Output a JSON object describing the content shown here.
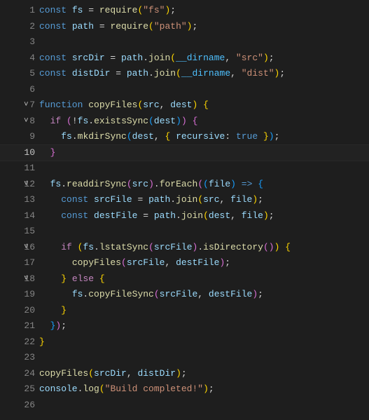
{
  "editor": {
    "language": "javascript",
    "active_line": 10,
    "lines": [
      {
        "n": 1,
        "fold": "",
        "tokens": [
          [
            "kw",
            "const"
          ],
          [
            "",
            ""
          ],
          [
            "var",
            " fs"
          ],
          [
            "punc",
            " = "
          ],
          [
            "fn",
            "require"
          ],
          [
            "brace-y",
            "("
          ],
          [
            "str",
            "\"fs\""
          ],
          [
            "brace-y",
            ")"
          ],
          [
            "punc",
            ";"
          ]
        ]
      },
      {
        "n": 2,
        "fold": "",
        "tokens": [
          [
            "kw",
            "const"
          ],
          [
            "var",
            " path"
          ],
          [
            "punc",
            " = "
          ],
          [
            "fn",
            "require"
          ],
          [
            "brace-y",
            "("
          ],
          [
            "str",
            "\"path\""
          ],
          [
            "brace-y",
            ")"
          ],
          [
            "punc",
            ";"
          ]
        ]
      },
      {
        "n": 3,
        "fold": "",
        "tokens": []
      },
      {
        "n": 4,
        "fold": "",
        "tokens": [
          [
            "kw",
            "const"
          ],
          [
            "var",
            " srcDir"
          ],
          [
            "punc",
            " = "
          ],
          [
            "var",
            "path"
          ],
          [
            "punc",
            "."
          ],
          [
            "fn",
            "join"
          ],
          [
            "brace-y",
            "("
          ],
          [
            "glob",
            "__dirname"
          ],
          [
            "punc",
            ", "
          ],
          [
            "str",
            "\"src\""
          ],
          [
            "brace-y",
            ")"
          ],
          [
            "punc",
            ";"
          ]
        ]
      },
      {
        "n": 5,
        "fold": "",
        "tokens": [
          [
            "kw",
            "const"
          ],
          [
            "var",
            " distDir"
          ],
          [
            "punc",
            " = "
          ],
          [
            "var",
            "path"
          ],
          [
            "punc",
            "."
          ],
          [
            "fn",
            "join"
          ],
          [
            "brace-y",
            "("
          ],
          [
            "glob",
            "__dirname"
          ],
          [
            "punc",
            ", "
          ],
          [
            "str",
            "\"dist\""
          ],
          [
            "brace-y",
            ")"
          ],
          [
            "punc",
            ";"
          ]
        ]
      },
      {
        "n": 6,
        "fold": "",
        "tokens": []
      },
      {
        "n": 7,
        "fold": "v",
        "tokens": [
          [
            "kw",
            "function"
          ],
          [
            "fn",
            " copyFiles"
          ],
          [
            "brace-y",
            "("
          ],
          [
            "param",
            "src"
          ],
          [
            "punc",
            ", "
          ],
          [
            "param",
            "dest"
          ],
          [
            "brace-y",
            ")"
          ],
          [
            "punc",
            " "
          ],
          [
            "brace-y",
            "{"
          ]
        ]
      },
      {
        "n": 8,
        "fold": "v",
        "tokens": [
          [
            "",
            "  "
          ],
          [
            "ctrl",
            "if"
          ],
          [
            "punc",
            " "
          ],
          [
            "brace-p",
            "("
          ],
          [
            "punc",
            "!"
          ],
          [
            "var",
            "fs"
          ],
          [
            "punc",
            "."
          ],
          [
            "fn",
            "existsSync"
          ],
          [
            "brace-b",
            "("
          ],
          [
            "var",
            "dest"
          ],
          [
            "brace-b",
            ")"
          ],
          [
            "brace-p",
            ")"
          ],
          [
            "punc",
            " "
          ],
          [
            "brace-p",
            "{"
          ]
        ]
      },
      {
        "n": 9,
        "fold": "",
        "tokens": [
          [
            "",
            "    "
          ],
          [
            "var",
            "fs"
          ],
          [
            "punc",
            "."
          ],
          [
            "fn",
            "mkdirSync"
          ],
          [
            "brace-b",
            "("
          ],
          [
            "var",
            "dest"
          ],
          [
            "punc",
            ", "
          ],
          [
            "brace-y",
            "{"
          ],
          [
            "prop",
            " recursive"
          ],
          [
            "punc",
            ":"
          ],
          [
            "kw",
            " true"
          ],
          [
            "brace-y",
            " }"
          ],
          [
            "brace-b",
            ")"
          ],
          [
            "punc",
            ";"
          ]
        ]
      },
      {
        "n": 10,
        "fold": "",
        "tokens": [
          [
            "",
            "  "
          ],
          [
            "brace-p",
            "}"
          ]
        ]
      },
      {
        "n": 11,
        "fold": "",
        "tokens": []
      },
      {
        "n": 12,
        "fold": "v",
        "tokens": [
          [
            "",
            "  "
          ],
          [
            "var",
            "fs"
          ],
          [
            "punc",
            "."
          ],
          [
            "fn",
            "readdirSync"
          ],
          [
            "brace-p",
            "("
          ],
          [
            "var",
            "src"
          ],
          [
            "brace-p",
            ")"
          ],
          [
            "punc",
            "."
          ],
          [
            "fn",
            "forEach"
          ],
          [
            "brace-p",
            "("
          ],
          [
            "brace-b",
            "("
          ],
          [
            "param",
            "file"
          ],
          [
            "brace-b",
            ")"
          ],
          [
            "arrow",
            " =>"
          ],
          [
            "punc",
            " "
          ],
          [
            "brace-b",
            "{"
          ]
        ]
      },
      {
        "n": 13,
        "fold": "",
        "tokens": [
          [
            "",
            "    "
          ],
          [
            "kw",
            "const"
          ],
          [
            "var",
            " srcFile"
          ],
          [
            "punc",
            " = "
          ],
          [
            "var",
            "path"
          ],
          [
            "punc",
            "."
          ],
          [
            "fn",
            "join"
          ],
          [
            "brace-y",
            "("
          ],
          [
            "var",
            "src"
          ],
          [
            "punc",
            ", "
          ],
          [
            "var",
            "file"
          ],
          [
            "brace-y",
            ")"
          ],
          [
            "punc",
            ";"
          ]
        ]
      },
      {
        "n": 14,
        "fold": "",
        "tokens": [
          [
            "",
            "    "
          ],
          [
            "kw",
            "const"
          ],
          [
            "var",
            " destFile"
          ],
          [
            "punc",
            " = "
          ],
          [
            "var",
            "path"
          ],
          [
            "punc",
            "."
          ],
          [
            "fn",
            "join"
          ],
          [
            "brace-y",
            "("
          ],
          [
            "var",
            "dest"
          ],
          [
            "punc",
            ", "
          ],
          [
            "var",
            "file"
          ],
          [
            "brace-y",
            ")"
          ],
          [
            "punc",
            ";"
          ]
        ]
      },
      {
        "n": 15,
        "fold": "",
        "tokens": []
      },
      {
        "n": 16,
        "fold": "v",
        "tokens": [
          [
            "",
            "    "
          ],
          [
            "ctrl",
            "if"
          ],
          [
            "punc",
            " "
          ],
          [
            "brace-y",
            "("
          ],
          [
            "var",
            "fs"
          ],
          [
            "punc",
            "."
          ],
          [
            "fn",
            "lstatSync"
          ],
          [
            "brace-p",
            "("
          ],
          [
            "var",
            "srcFile"
          ],
          [
            "brace-p",
            ")"
          ],
          [
            "punc",
            "."
          ],
          [
            "fn",
            "isDirectory"
          ],
          [
            "brace-p",
            "("
          ],
          [
            "brace-p",
            ")"
          ],
          [
            "brace-y",
            ")"
          ],
          [
            "punc",
            " "
          ],
          [
            "brace-y",
            "{"
          ]
        ]
      },
      {
        "n": 17,
        "fold": "",
        "tokens": [
          [
            "",
            "      "
          ],
          [
            "fn",
            "copyFiles"
          ],
          [
            "brace-p",
            "("
          ],
          [
            "var",
            "srcFile"
          ],
          [
            "punc",
            ", "
          ],
          [
            "var",
            "destFile"
          ],
          [
            "brace-p",
            ")"
          ],
          [
            "punc",
            ";"
          ]
        ]
      },
      {
        "n": 18,
        "fold": "v",
        "tokens": [
          [
            "",
            "    "
          ],
          [
            "brace-y",
            "}"
          ],
          [
            "ctrl",
            " else"
          ],
          [
            "punc",
            " "
          ],
          [
            "brace-y",
            "{"
          ]
        ]
      },
      {
        "n": 19,
        "fold": "",
        "tokens": [
          [
            "",
            "      "
          ],
          [
            "var",
            "fs"
          ],
          [
            "punc",
            "."
          ],
          [
            "fn",
            "copyFileSync"
          ],
          [
            "brace-p",
            "("
          ],
          [
            "var",
            "srcFile"
          ],
          [
            "punc",
            ", "
          ],
          [
            "var",
            "destFile"
          ],
          [
            "brace-p",
            ")"
          ],
          [
            "punc",
            ";"
          ]
        ]
      },
      {
        "n": 20,
        "fold": "",
        "tokens": [
          [
            "",
            "    "
          ],
          [
            "brace-y",
            "}"
          ]
        ]
      },
      {
        "n": 21,
        "fold": "",
        "tokens": [
          [
            "",
            "  "
          ],
          [
            "brace-b",
            "}"
          ],
          [
            "brace-p",
            ")"
          ],
          [
            "punc",
            ";"
          ]
        ]
      },
      {
        "n": 22,
        "fold": "",
        "tokens": [
          [
            "brace-y",
            "}"
          ]
        ]
      },
      {
        "n": 23,
        "fold": "",
        "tokens": []
      },
      {
        "n": 24,
        "fold": "",
        "tokens": [
          [
            "fn",
            "copyFiles"
          ],
          [
            "brace-y",
            "("
          ],
          [
            "var",
            "srcDir"
          ],
          [
            "punc",
            ", "
          ],
          [
            "var",
            "distDir"
          ],
          [
            "brace-y",
            ")"
          ],
          [
            "punc",
            ";"
          ]
        ]
      },
      {
        "n": 25,
        "fold": "",
        "tokens": [
          [
            "var",
            "console"
          ],
          [
            "punc",
            "."
          ],
          [
            "fn",
            "log"
          ],
          [
            "brace-y",
            "("
          ],
          [
            "str",
            "\"Build completed!\""
          ],
          [
            "brace-y",
            ")"
          ],
          [
            "punc",
            ";"
          ]
        ]
      },
      {
        "n": 26,
        "fold": "",
        "tokens": []
      }
    ]
  }
}
